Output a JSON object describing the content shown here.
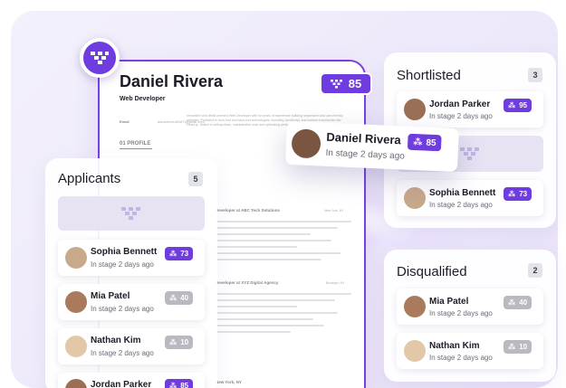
{
  "resume": {
    "name": "Daniel Rivera",
    "role": "Web Developer",
    "email_label": "Email",
    "email_value": "danielrivera9187@gmail.com",
    "profile_heading": "01  PROFILE",
    "profile_text": "Innovative and detail-oriented Web Developer with for years of experience building responsive and user-friendly websites. Proficient in front-end and back-end technologies, including JavaScript, and modern frameworks like React.js. Skilled in writing clean, maintainable code and optimizing performance.",
    "score": "85",
    "jobs": [
      {
        "title": "Developer at ABC Tech Solutions",
        "location": "New York, NY"
      },
      {
        "title": "Developer at XYZ Digital Agency",
        "location": "Brooklyn, NY"
      },
      {
        "title": "New York, NY",
        "location": ""
      }
    ]
  },
  "dragged": {
    "name": "Daniel Rivera",
    "subtitle": "In stage 2 days ago",
    "score": "85"
  },
  "applicants": {
    "title": "Applicants",
    "count": "5",
    "items": [
      {
        "name": "Sophia Bennett",
        "subtitle": "In stage 2 days ago",
        "score": "73",
        "active": true
      },
      {
        "name": "Mia Patel",
        "subtitle": "In stage 2 days ago",
        "score": "40",
        "active": false
      },
      {
        "name": "Nathan Kim",
        "subtitle": "In stage 2 days ago",
        "score": "10",
        "active": false
      },
      {
        "name": "Jordan Parker",
        "subtitle": "",
        "score": "85",
        "active": true
      }
    ]
  },
  "shortlisted": {
    "title": "Shortlisted",
    "count": "3",
    "items": [
      {
        "name": "Jordan Parker",
        "subtitle": "In stage 2 days ago",
        "score": "95",
        "active": true
      },
      {
        "name": "Sophia Bennett",
        "subtitle": "In stage 2 days ago",
        "score": "73",
        "active": true
      }
    ]
  },
  "disqualified": {
    "title": "Disqualified",
    "count": "2",
    "items": [
      {
        "name": "Mia Patel",
        "subtitle": "In stage 2 days ago",
        "score": "40",
        "active": false
      },
      {
        "name": "Nathan Kim",
        "subtitle": "In stage 2 days ago",
        "score": "10",
        "active": false
      }
    ]
  },
  "colors": {
    "accent": "#6f3ce0",
    "inactive": "#b9b9c2"
  }
}
